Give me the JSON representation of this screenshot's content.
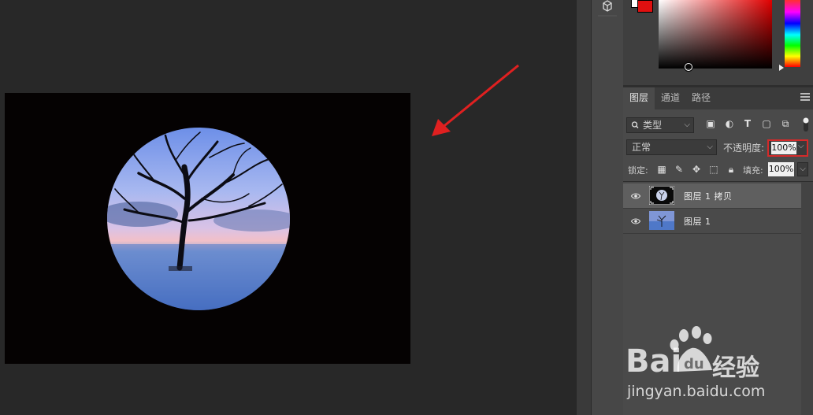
{
  "dock": {
    "icon": "3d-cube-icon"
  },
  "color_panel": {
    "foreground": "#e01010",
    "background": "#ffffff"
  },
  "layers_panel": {
    "tabs": [
      {
        "label": "图层",
        "active": true
      },
      {
        "label": "通道",
        "active": false
      },
      {
        "label": "路径",
        "active": false
      }
    ],
    "filter": {
      "label": "类型",
      "icon": "search-icon"
    },
    "filter_icons": [
      "image-icon",
      "adjustment-icon",
      "type-icon",
      "shape-icon",
      "smart-object-icon",
      "toggle-icon"
    ],
    "blend_mode": "正常",
    "opacity_label": "不透明度:",
    "opacity_value": "100%",
    "lock_label": "锁定:",
    "lock_icons": [
      "lock-transparent-icon",
      "lock-paint-icon",
      "lock-move-icon",
      "lock-artboard-icon",
      "lock-all-icon"
    ],
    "fill_label": "填充:",
    "fill_value": "100%",
    "layers": [
      {
        "name": "图层 1 拷贝",
        "selected": true,
        "visible": true
      },
      {
        "name": "图层 1",
        "selected": false,
        "visible": true
      }
    ]
  },
  "annotation": {
    "arrow_color": "#e02020",
    "highlight_color": "#d42a2a"
  },
  "watermark": {
    "brand": "Bai",
    "brand_suffix": "du",
    "product": "经验",
    "url": "jingyan.baidu.com"
  }
}
